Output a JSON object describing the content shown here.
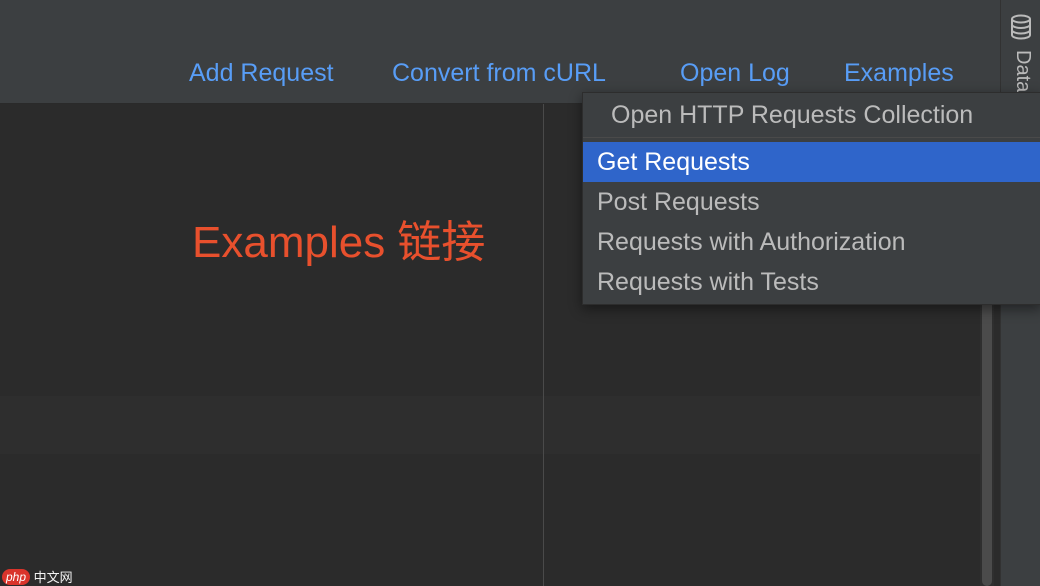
{
  "toolbar": {
    "add_request": "Add Request",
    "convert_curl": "Convert from cURL",
    "open_log": "Open Log",
    "examples": "Examples"
  },
  "annotation": {
    "text": "Examples 链接"
  },
  "side_panel": {
    "label": "Data",
    "icon": "database-icon"
  },
  "popup": {
    "header": "Open HTTP Requests Collection",
    "items": [
      {
        "label": "Get Requests",
        "selected": true
      },
      {
        "label": "Post Requests",
        "selected": false
      },
      {
        "label": "Requests with Authorization",
        "selected": false
      },
      {
        "label": "Requests with Tests",
        "selected": false
      }
    ]
  },
  "watermark": {
    "badge": "php",
    "text": "中文网"
  },
  "colors": {
    "link": "#589df6",
    "annotation": "#e8502d",
    "selection": "#2f65ca",
    "panel_bg": "#3c3f41",
    "editor_bg": "#2b2b2b"
  }
}
